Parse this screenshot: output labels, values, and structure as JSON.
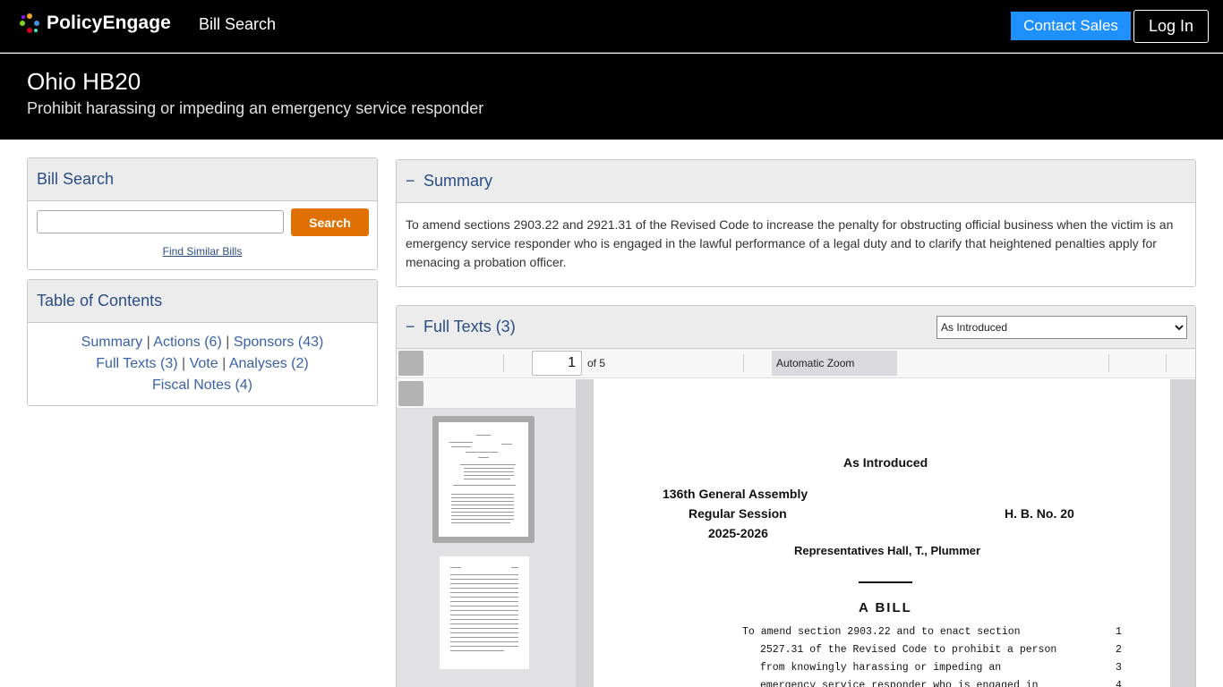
{
  "nav": {
    "brand": "PolicyEngage",
    "bill_search_link": "Bill Search",
    "contact_sales": "Contact Sales",
    "log_in": "Log In"
  },
  "bill": {
    "title": "Ohio HB20",
    "subtitle": "Prohibit harassing or impeding an emergency service responder"
  },
  "search_panel": {
    "heading": "Bill Search",
    "input_value": "",
    "button": "Search",
    "similar_link": "Find Similar Bills"
  },
  "toc": {
    "heading": "Table of Contents",
    "links": [
      "Summary",
      "Actions (6)",
      "Sponsors (43)",
      "Full Texts (3)",
      "Vote",
      "Analyses (2)",
      "Fiscal Notes (4)"
    ],
    "separator": "|"
  },
  "summary": {
    "toggle": "−",
    "heading": "Summary",
    "text": "To amend sections 2903.22 and 2921.31 of the Revised Code to increase the penalty for obstructing official business when the victim is an emergency service responder who is engaged in the lawful performance of a legal duty and to clarify that heightened penalties apply for menacing a probation officer."
  },
  "full_texts": {
    "toggle": "−",
    "heading": "Full Texts (3)",
    "version_selected": "As Introduced",
    "viewer": {
      "page_value": "1",
      "page_of": "of 5",
      "zoom": "Automatic Zoom"
    },
    "document": {
      "status": "As Introduced",
      "assembly": "136th General Assembly",
      "session": "Regular Session",
      "bill_no": "H. B. No. 20",
      "years": "2025-2026",
      "sponsors": "Representatives Hall, T., Plummer",
      "a_bill": "A BILL",
      "lines": [
        {
          "text": "To amend section 2903.22 and to enact section",
          "num": "1"
        },
        {
          "text": "2527.31 of the Revised Code to prohibit a person",
          "num": "2"
        },
        {
          "text": "from knowingly harassing or impeding an",
          "num": "3"
        },
        {
          "text": "emergency service responder who is engaged in",
          "num": "4"
        }
      ]
    }
  },
  "colors": {
    "accent_blue": "#1e90ff",
    "search_orange": "#e07100",
    "heading_blue": "#2a4d84",
    "link_blue": "#3a62a8"
  }
}
